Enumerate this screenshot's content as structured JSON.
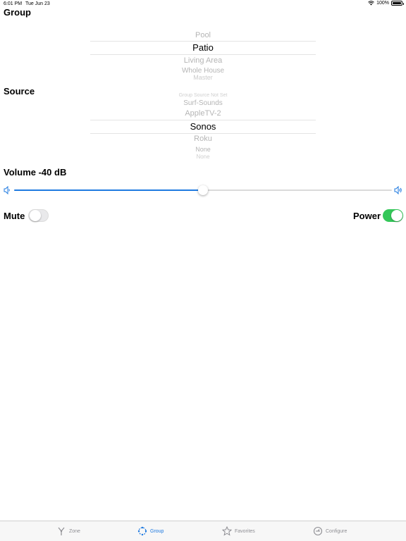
{
  "status_bar": {
    "time": "6:01 PM",
    "date": "Tue Jun 23",
    "battery": "100%"
  },
  "group": {
    "label": "Group",
    "options": [
      "Pool",
      "Patio",
      "Living Area",
      "Whole House",
      "Master"
    ],
    "selected": "Patio"
  },
  "source": {
    "label": "Source",
    "options": [
      "Group Source Not Set",
      "Surf-Sounds",
      "AppleTV-2",
      "Sonos",
      "Roku",
      "None",
      "None"
    ],
    "selected": "Sonos"
  },
  "volume": {
    "label": "Volume -40 dB",
    "level": 0.5
  },
  "mute": {
    "label": "Mute",
    "on": false
  },
  "power": {
    "label": "Power",
    "on": true
  },
  "tab_bar": {
    "tabs": [
      {
        "label": "Zone",
        "icon": "antenna-icon"
      },
      {
        "label": "Group",
        "icon": "speaker-group-icon",
        "active": true
      },
      {
        "label": "Favorites",
        "icon": "star-icon"
      },
      {
        "label": "Configure",
        "icon": "configure-icon"
      }
    ]
  },
  "colors": {
    "accent": "#1f7ae0",
    "toggle_on": "#34c759",
    "toggle_off": "#e9e9eb"
  }
}
